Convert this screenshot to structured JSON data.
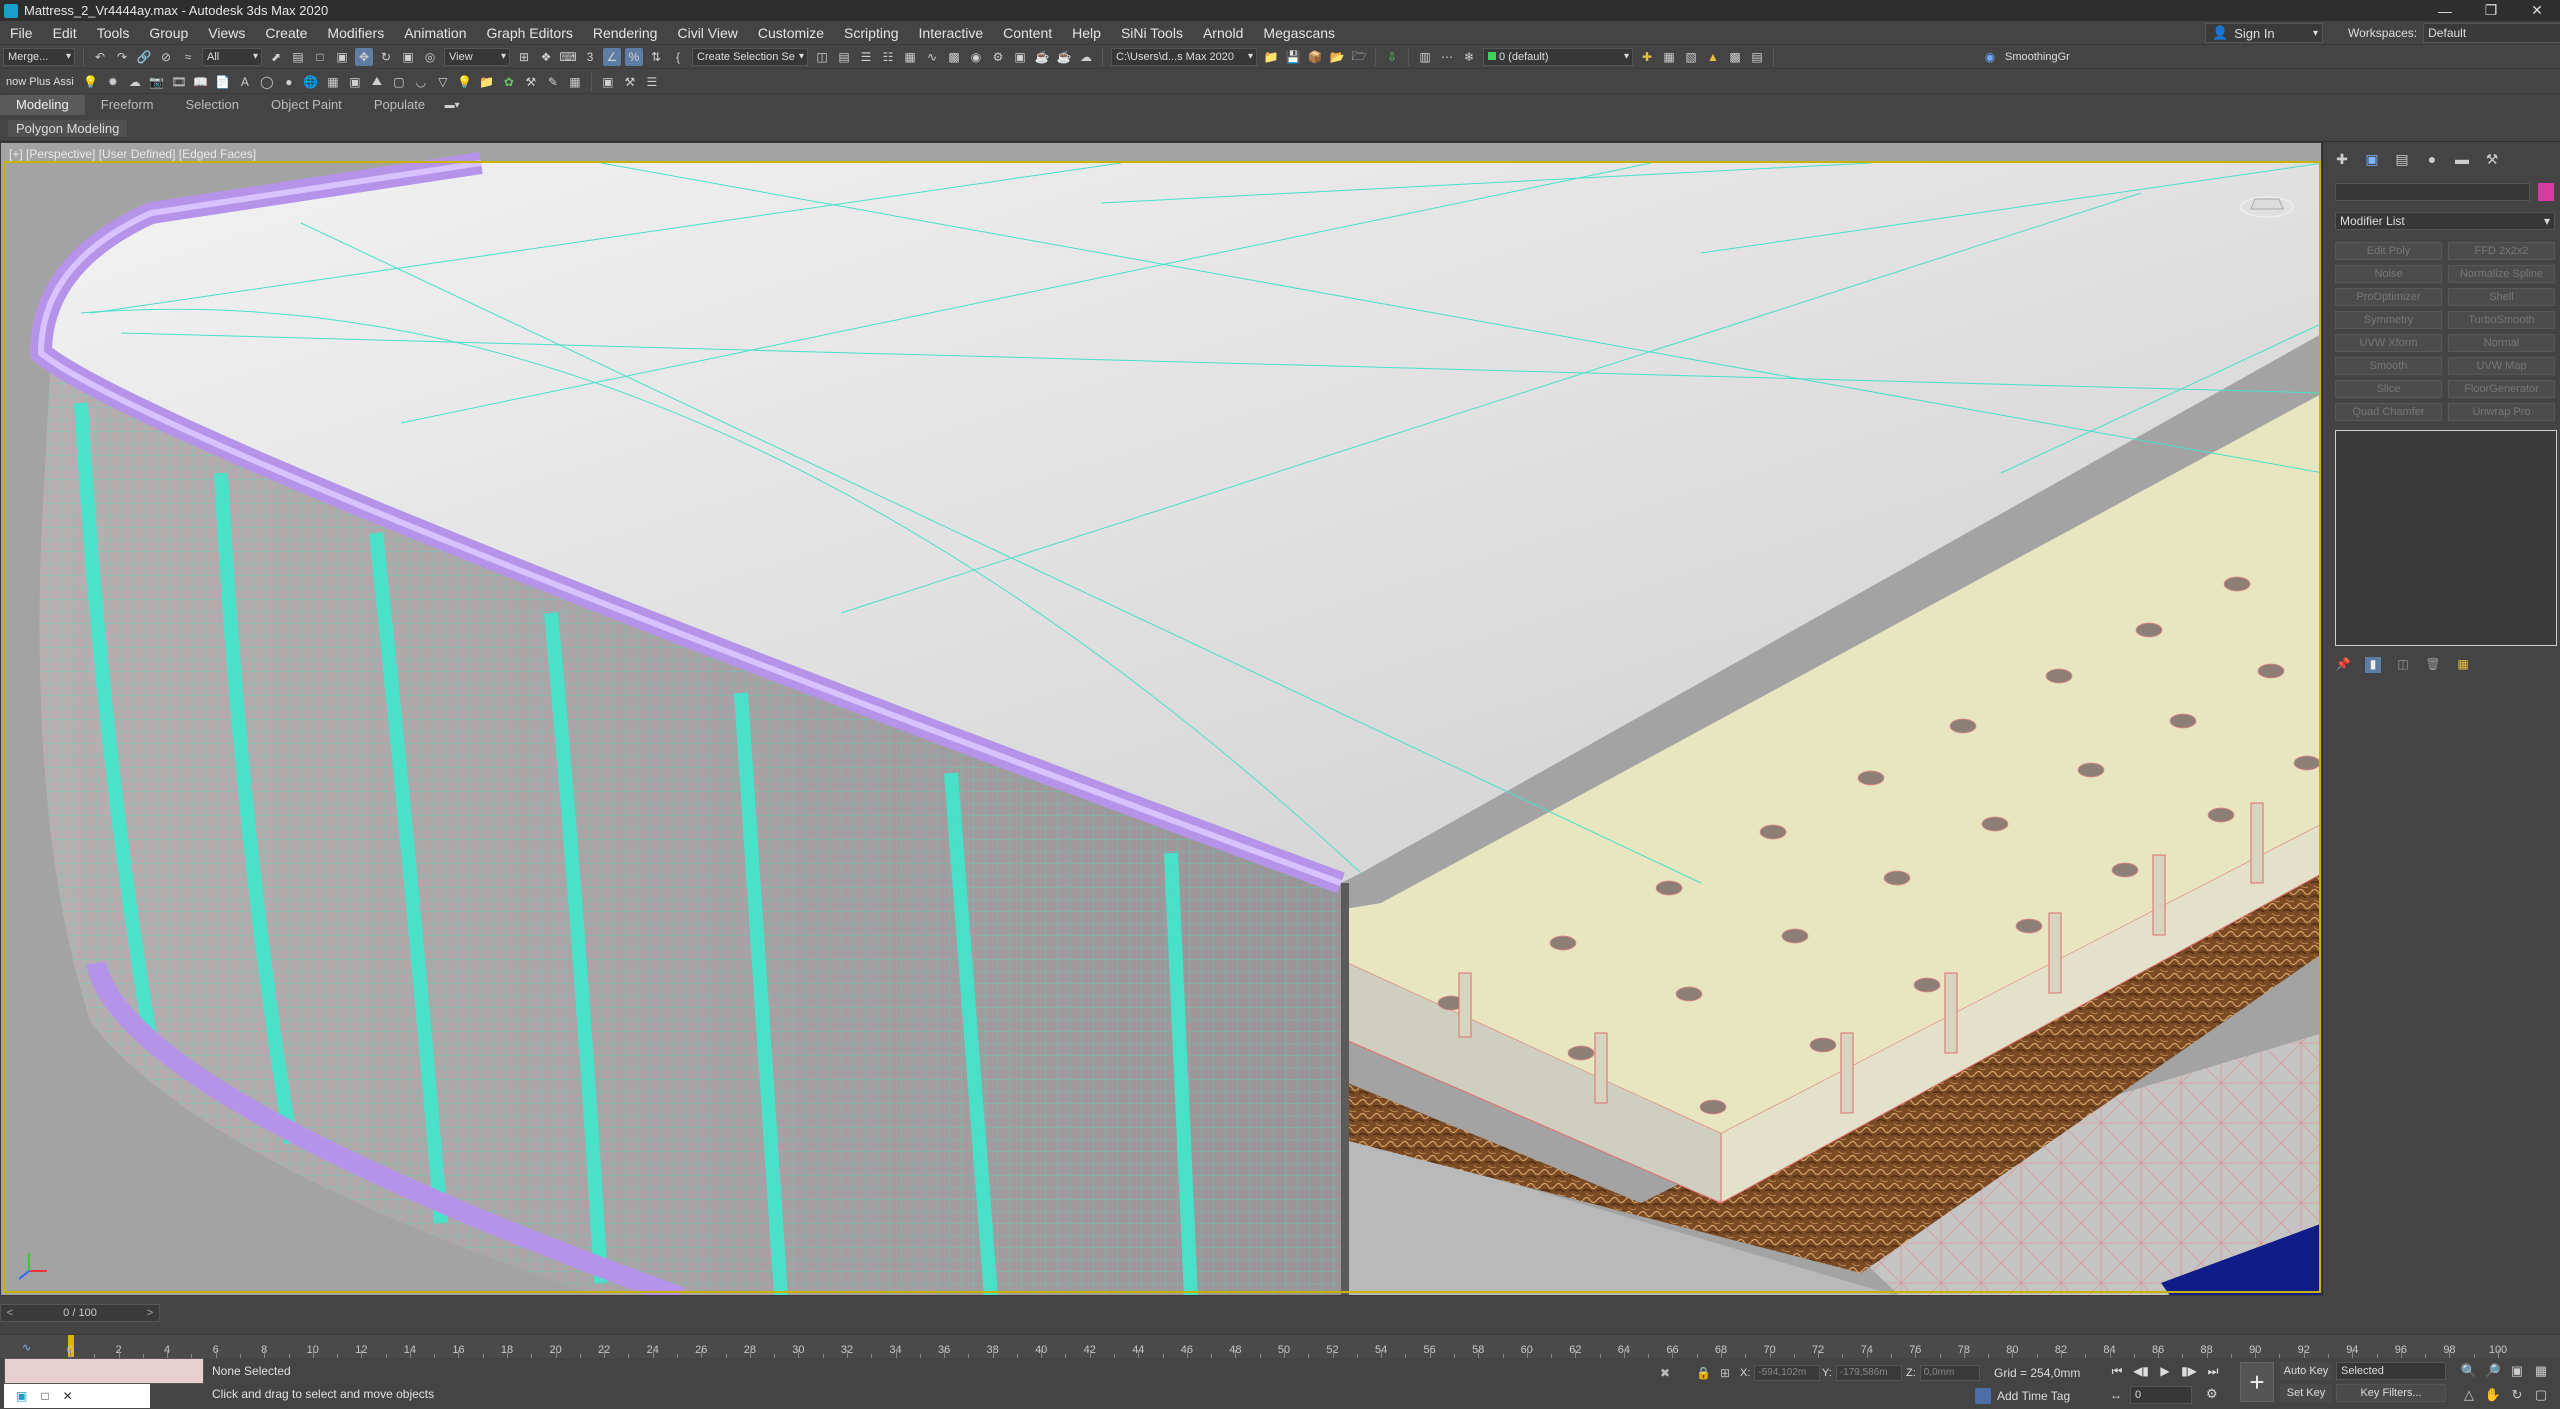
{
  "title": "Mattress_2_Vr4444ay.max - Autodesk 3ds Max 2020",
  "menu": [
    "File",
    "Edit",
    "Tools",
    "Group",
    "Views",
    "Create",
    "Modifiers",
    "Animation",
    "Graph Editors",
    "Rendering",
    "Civil View",
    "Customize",
    "Scripting",
    "Interactive",
    "Content",
    "Help",
    "SiNi Tools",
    "Arnold",
    "Megascans"
  ],
  "account": {
    "sign_in": "Sign In"
  },
  "workspaces": {
    "label": "Workspaces:",
    "value": "Default"
  },
  "toolbar1": {
    "merge": "Merge...",
    "selection_filter": "All",
    "ref_coord": "View",
    "named_selection": "Create Selection Se",
    "project_path": "C:\\Users\\d...s Max 2020",
    "layer": "0 (default)",
    "smoothing": "SmoothingGr"
  },
  "toolbar2": {
    "assist": "now Plus Assi"
  },
  "ribbon": {
    "tabs": [
      "Modeling",
      "Freeform",
      "Selection",
      "Object Paint",
      "Populate"
    ],
    "active": "Modeling",
    "panel_label": "Polygon Modeling"
  },
  "viewport": {
    "label": "[+] [Perspective] [User Defined] [Edged Faces]"
  },
  "command_panel": {
    "modifier_list": "Modifier List",
    "modifiers": [
      "Edit Poly",
      "FFD 2x2x2",
      "Noise",
      "Normalize Spline",
      "ProOptimizer",
      "Shell",
      "Symmetry",
      "TurboSmooth",
      "UVW Xform",
      "Normal",
      "Smooth",
      "UVW Map",
      "Slice",
      "FloorGenerator",
      "Quad Chamfer",
      "Unwrap Pro"
    ],
    "object_color": "#d83aa0"
  },
  "timeslider": {
    "frame": "0 / 100"
  },
  "track": {
    "ticks": [
      "0",
      "2",
      "4",
      "6",
      "8",
      "10",
      "12",
      "14",
      "16",
      "18",
      "20",
      "22",
      "24",
      "26",
      "28",
      "30",
      "32",
      "34",
      "36",
      "38",
      "40",
      "42",
      "44",
      "46",
      "48",
      "50",
      "52",
      "54",
      "56",
      "58",
      "60",
      "62",
      "64",
      "66",
      "68",
      "70",
      "72",
      "74",
      "76",
      "78",
      "80",
      "82",
      "84",
      "86",
      "88",
      "90",
      "92",
      "94",
      "96",
      "98",
      "100"
    ]
  },
  "status": {
    "selection": "None Selected",
    "prompt": "Click and drag to select and move objects",
    "x_label": "X:",
    "x_value": "-594,102m",
    "y_label": "Y:",
    "y_value": "-179,586m",
    "z_label": "Z:",
    "z_value": "0,0mm",
    "grid": "Grid = 254,0mm",
    "add_time_tag": "Add Time Tag",
    "frame_field": "0",
    "auto_key": "Auto Key",
    "set_key": "Set Key",
    "key_mode": "Selected",
    "key_filters": "Key Filters..."
  }
}
